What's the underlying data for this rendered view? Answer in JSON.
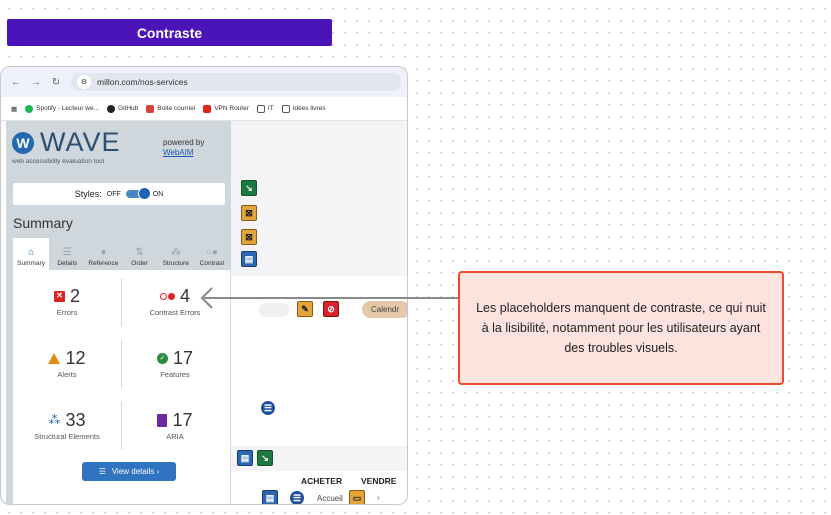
{
  "banner": {
    "title": "Contraste"
  },
  "browser": {
    "url": "millon.com/nos-services",
    "bookmarks": [
      "Spotify - Lecteur we...",
      "GitHub",
      "Boite courriel",
      "VPN Router",
      "IT",
      "Idées livres"
    ]
  },
  "wave": {
    "logo_text": "WAVE",
    "subtitle": "web accessibility evaluation tool",
    "powered_by": "powered by",
    "powered_link": "WebAIM",
    "styles_label": "Styles:",
    "styles_off": "OFF",
    "styles_on": "ON",
    "summary_title": "Summary",
    "tabs": [
      {
        "label": "Summary",
        "icon": "home-icon"
      },
      {
        "label": "Details",
        "icon": "list-icon"
      },
      {
        "label": "Reference",
        "icon": "info-icon"
      },
      {
        "label": "Order",
        "icon": "order-icon"
      },
      {
        "label": "Structure",
        "icon": "structure-icon"
      },
      {
        "label": "Contrast",
        "icon": "contrast-icon"
      }
    ],
    "stats": {
      "errors": {
        "value": "2",
        "label": "Errors"
      },
      "contrast_errors": {
        "value": "4",
        "label": "Contrast Errors"
      },
      "alerts": {
        "value": "12",
        "label": "Alerts"
      },
      "features": {
        "value": "17",
        "label": "Features"
      },
      "structural": {
        "value": "33",
        "label": "Structural Elements"
      },
      "aria": {
        "value": "17",
        "label": "ARIA"
      }
    },
    "view_details": "View details ›"
  },
  "page": {
    "calendar_label": "Calendr",
    "nav": [
      "ACHETER",
      "VENDRE"
    ],
    "breadcrumb": "Accueil",
    "breadcrumb_sep": "›"
  },
  "callout": {
    "text": "Les placeholders manquent de contraste, ce qui nuit à la lisibilité, notamment pour les utilisateurs ayant des troubles visuels."
  },
  "colors": {
    "banner": "#4a14b8",
    "callout_border": "#ee4b2b",
    "callout_bg": "#fce3dd"
  }
}
